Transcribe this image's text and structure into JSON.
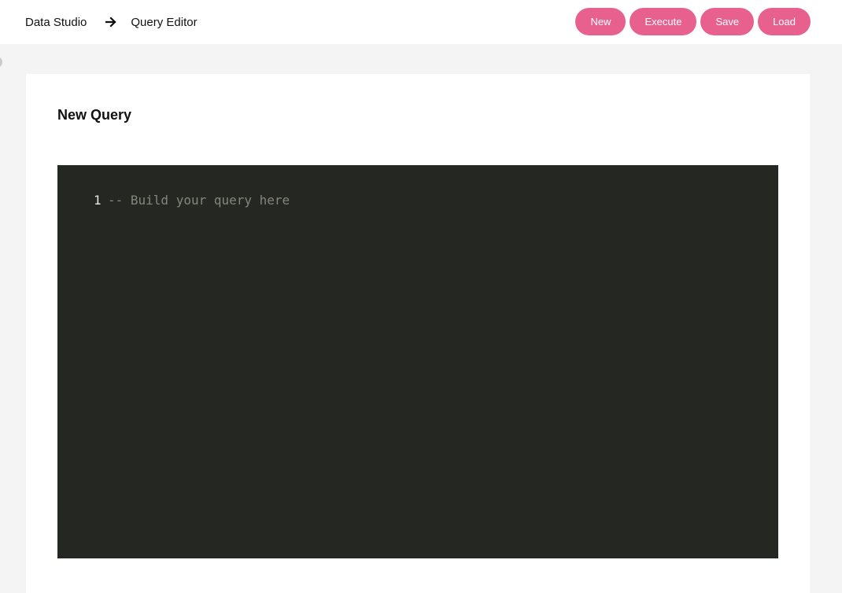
{
  "breadcrumb": {
    "root": "Data Studio",
    "current": "Query Editor",
    "separator_icon": "arrow-right-icon"
  },
  "toolbar": {
    "new_label": "New",
    "execute_label": "Execute",
    "save_label": "Save",
    "load_label": "Load",
    "button_color": "#e8608e"
  },
  "card": {
    "title": "New Query"
  },
  "editor": {
    "background": "#252822",
    "lines": [
      {
        "number": "1",
        "text": "-- Build your query here"
      }
    ]
  }
}
